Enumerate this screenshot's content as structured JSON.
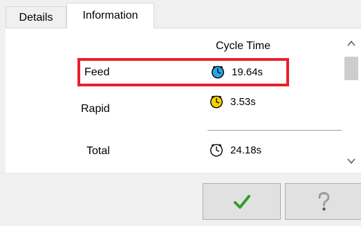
{
  "tabs": [
    {
      "label": "Details",
      "active": false
    },
    {
      "label": "Information",
      "active": true
    }
  ],
  "info": {
    "header": "Cycle Time",
    "rows": [
      {
        "label": "Feed",
        "value": "19.64s",
        "icon": "clock-blue-icon",
        "color": "#29a8e0",
        "highlighted": true
      },
      {
        "label": "Rapid",
        "value": "3.53s",
        "icon": "clock-yellow-icon",
        "color": "#f5d000",
        "highlighted": false
      },
      {
        "label": "Total",
        "value": "24.18s",
        "icon": "clock-white-icon",
        "color": "#ffffff",
        "highlighted": false
      }
    ]
  },
  "colors": {
    "highlight_border": "#e8202a",
    "ok_check": "#2e9e2e"
  },
  "buttons": {
    "ok_icon": "checkmark-icon",
    "help_icon": "question-mark-icon"
  }
}
